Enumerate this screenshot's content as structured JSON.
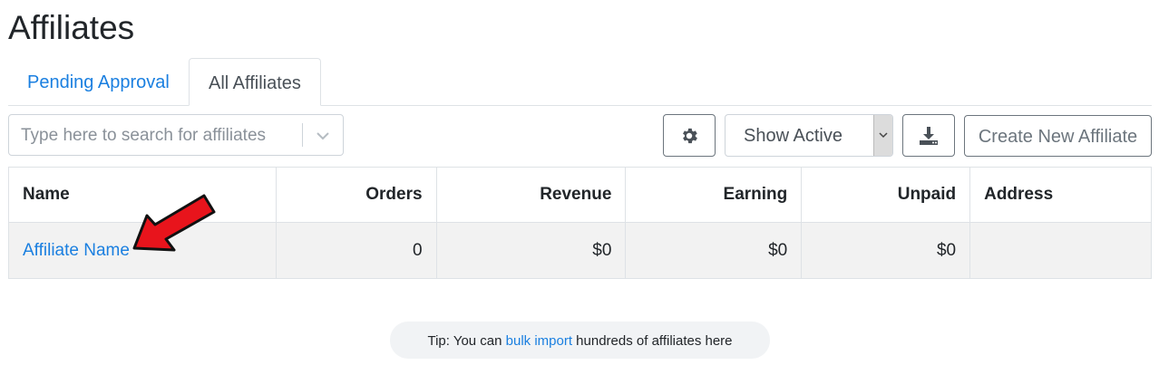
{
  "page": {
    "title": "Affiliates"
  },
  "tabs": [
    {
      "label": "Pending Approval",
      "active": false
    },
    {
      "label": "All Affiliates",
      "active": true
    }
  ],
  "toolbar": {
    "search_placeholder": "Type here to search for affiliates",
    "filter_value": "Show Active",
    "create_label": "Create New Affiliate",
    "settings_icon": "gear-icon",
    "download_icon": "download-icon"
  },
  "table": {
    "headers": [
      "Name",
      "Orders",
      "Revenue",
      "Earning",
      "Unpaid",
      "Address"
    ],
    "rows": [
      {
        "name": "Affiliate Name",
        "orders": "0",
        "revenue": "$0",
        "earning": "$0",
        "unpaid": "$0",
        "address": ""
      }
    ]
  },
  "tip": {
    "prefix": "Tip: You can ",
    "link": "bulk import",
    "suffix": " hundreds of affiliates here"
  },
  "colors": {
    "link": "#1a7fe0",
    "annotation_arrow": "#e8141c"
  }
}
